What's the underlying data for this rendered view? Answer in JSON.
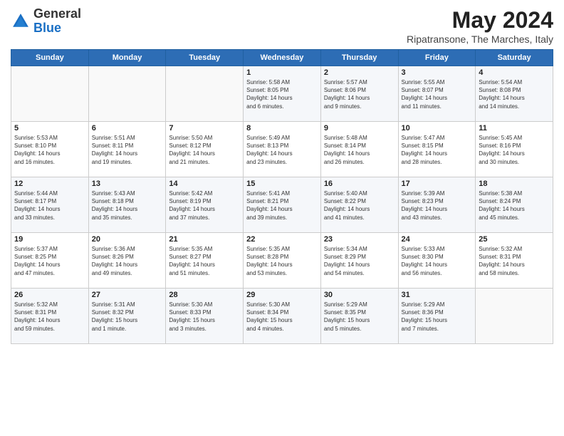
{
  "header": {
    "logo_general": "General",
    "logo_blue": "Blue",
    "month_title": "May 2024",
    "location": "Ripatransone, The Marches, Italy"
  },
  "days_of_week": [
    "Sunday",
    "Monday",
    "Tuesday",
    "Wednesday",
    "Thursday",
    "Friday",
    "Saturday"
  ],
  "weeks": [
    [
      {
        "day": "",
        "info": ""
      },
      {
        "day": "",
        "info": ""
      },
      {
        "day": "",
        "info": ""
      },
      {
        "day": "1",
        "info": "Sunrise: 5:58 AM\nSunset: 8:05 PM\nDaylight: 14 hours\nand 6 minutes."
      },
      {
        "day": "2",
        "info": "Sunrise: 5:57 AM\nSunset: 8:06 PM\nDaylight: 14 hours\nand 9 minutes."
      },
      {
        "day": "3",
        "info": "Sunrise: 5:55 AM\nSunset: 8:07 PM\nDaylight: 14 hours\nand 11 minutes."
      },
      {
        "day": "4",
        "info": "Sunrise: 5:54 AM\nSunset: 8:08 PM\nDaylight: 14 hours\nand 14 minutes."
      }
    ],
    [
      {
        "day": "5",
        "info": "Sunrise: 5:53 AM\nSunset: 8:10 PM\nDaylight: 14 hours\nand 16 minutes."
      },
      {
        "day": "6",
        "info": "Sunrise: 5:51 AM\nSunset: 8:11 PM\nDaylight: 14 hours\nand 19 minutes."
      },
      {
        "day": "7",
        "info": "Sunrise: 5:50 AM\nSunset: 8:12 PM\nDaylight: 14 hours\nand 21 minutes."
      },
      {
        "day": "8",
        "info": "Sunrise: 5:49 AM\nSunset: 8:13 PM\nDaylight: 14 hours\nand 23 minutes."
      },
      {
        "day": "9",
        "info": "Sunrise: 5:48 AM\nSunset: 8:14 PM\nDaylight: 14 hours\nand 26 minutes."
      },
      {
        "day": "10",
        "info": "Sunrise: 5:47 AM\nSunset: 8:15 PM\nDaylight: 14 hours\nand 28 minutes."
      },
      {
        "day": "11",
        "info": "Sunrise: 5:45 AM\nSunset: 8:16 PM\nDaylight: 14 hours\nand 30 minutes."
      }
    ],
    [
      {
        "day": "12",
        "info": "Sunrise: 5:44 AM\nSunset: 8:17 PM\nDaylight: 14 hours\nand 33 minutes."
      },
      {
        "day": "13",
        "info": "Sunrise: 5:43 AM\nSunset: 8:18 PM\nDaylight: 14 hours\nand 35 minutes."
      },
      {
        "day": "14",
        "info": "Sunrise: 5:42 AM\nSunset: 8:19 PM\nDaylight: 14 hours\nand 37 minutes."
      },
      {
        "day": "15",
        "info": "Sunrise: 5:41 AM\nSunset: 8:21 PM\nDaylight: 14 hours\nand 39 minutes."
      },
      {
        "day": "16",
        "info": "Sunrise: 5:40 AM\nSunset: 8:22 PM\nDaylight: 14 hours\nand 41 minutes."
      },
      {
        "day": "17",
        "info": "Sunrise: 5:39 AM\nSunset: 8:23 PM\nDaylight: 14 hours\nand 43 minutes."
      },
      {
        "day": "18",
        "info": "Sunrise: 5:38 AM\nSunset: 8:24 PM\nDaylight: 14 hours\nand 45 minutes."
      }
    ],
    [
      {
        "day": "19",
        "info": "Sunrise: 5:37 AM\nSunset: 8:25 PM\nDaylight: 14 hours\nand 47 minutes."
      },
      {
        "day": "20",
        "info": "Sunrise: 5:36 AM\nSunset: 8:26 PM\nDaylight: 14 hours\nand 49 minutes."
      },
      {
        "day": "21",
        "info": "Sunrise: 5:35 AM\nSunset: 8:27 PM\nDaylight: 14 hours\nand 51 minutes."
      },
      {
        "day": "22",
        "info": "Sunrise: 5:35 AM\nSunset: 8:28 PM\nDaylight: 14 hours\nand 53 minutes."
      },
      {
        "day": "23",
        "info": "Sunrise: 5:34 AM\nSunset: 8:29 PM\nDaylight: 14 hours\nand 54 minutes."
      },
      {
        "day": "24",
        "info": "Sunrise: 5:33 AM\nSunset: 8:30 PM\nDaylight: 14 hours\nand 56 minutes."
      },
      {
        "day": "25",
        "info": "Sunrise: 5:32 AM\nSunset: 8:31 PM\nDaylight: 14 hours\nand 58 minutes."
      }
    ],
    [
      {
        "day": "26",
        "info": "Sunrise: 5:32 AM\nSunset: 8:31 PM\nDaylight: 14 hours\nand 59 minutes."
      },
      {
        "day": "27",
        "info": "Sunrise: 5:31 AM\nSunset: 8:32 PM\nDaylight: 15 hours\nand 1 minute."
      },
      {
        "day": "28",
        "info": "Sunrise: 5:30 AM\nSunset: 8:33 PM\nDaylight: 15 hours\nand 3 minutes."
      },
      {
        "day": "29",
        "info": "Sunrise: 5:30 AM\nSunset: 8:34 PM\nDaylight: 15 hours\nand 4 minutes."
      },
      {
        "day": "30",
        "info": "Sunrise: 5:29 AM\nSunset: 8:35 PM\nDaylight: 15 hours\nand 5 minutes."
      },
      {
        "day": "31",
        "info": "Sunrise: 5:29 AM\nSunset: 8:36 PM\nDaylight: 15 hours\nand 7 minutes."
      },
      {
        "day": "",
        "info": ""
      }
    ]
  ]
}
